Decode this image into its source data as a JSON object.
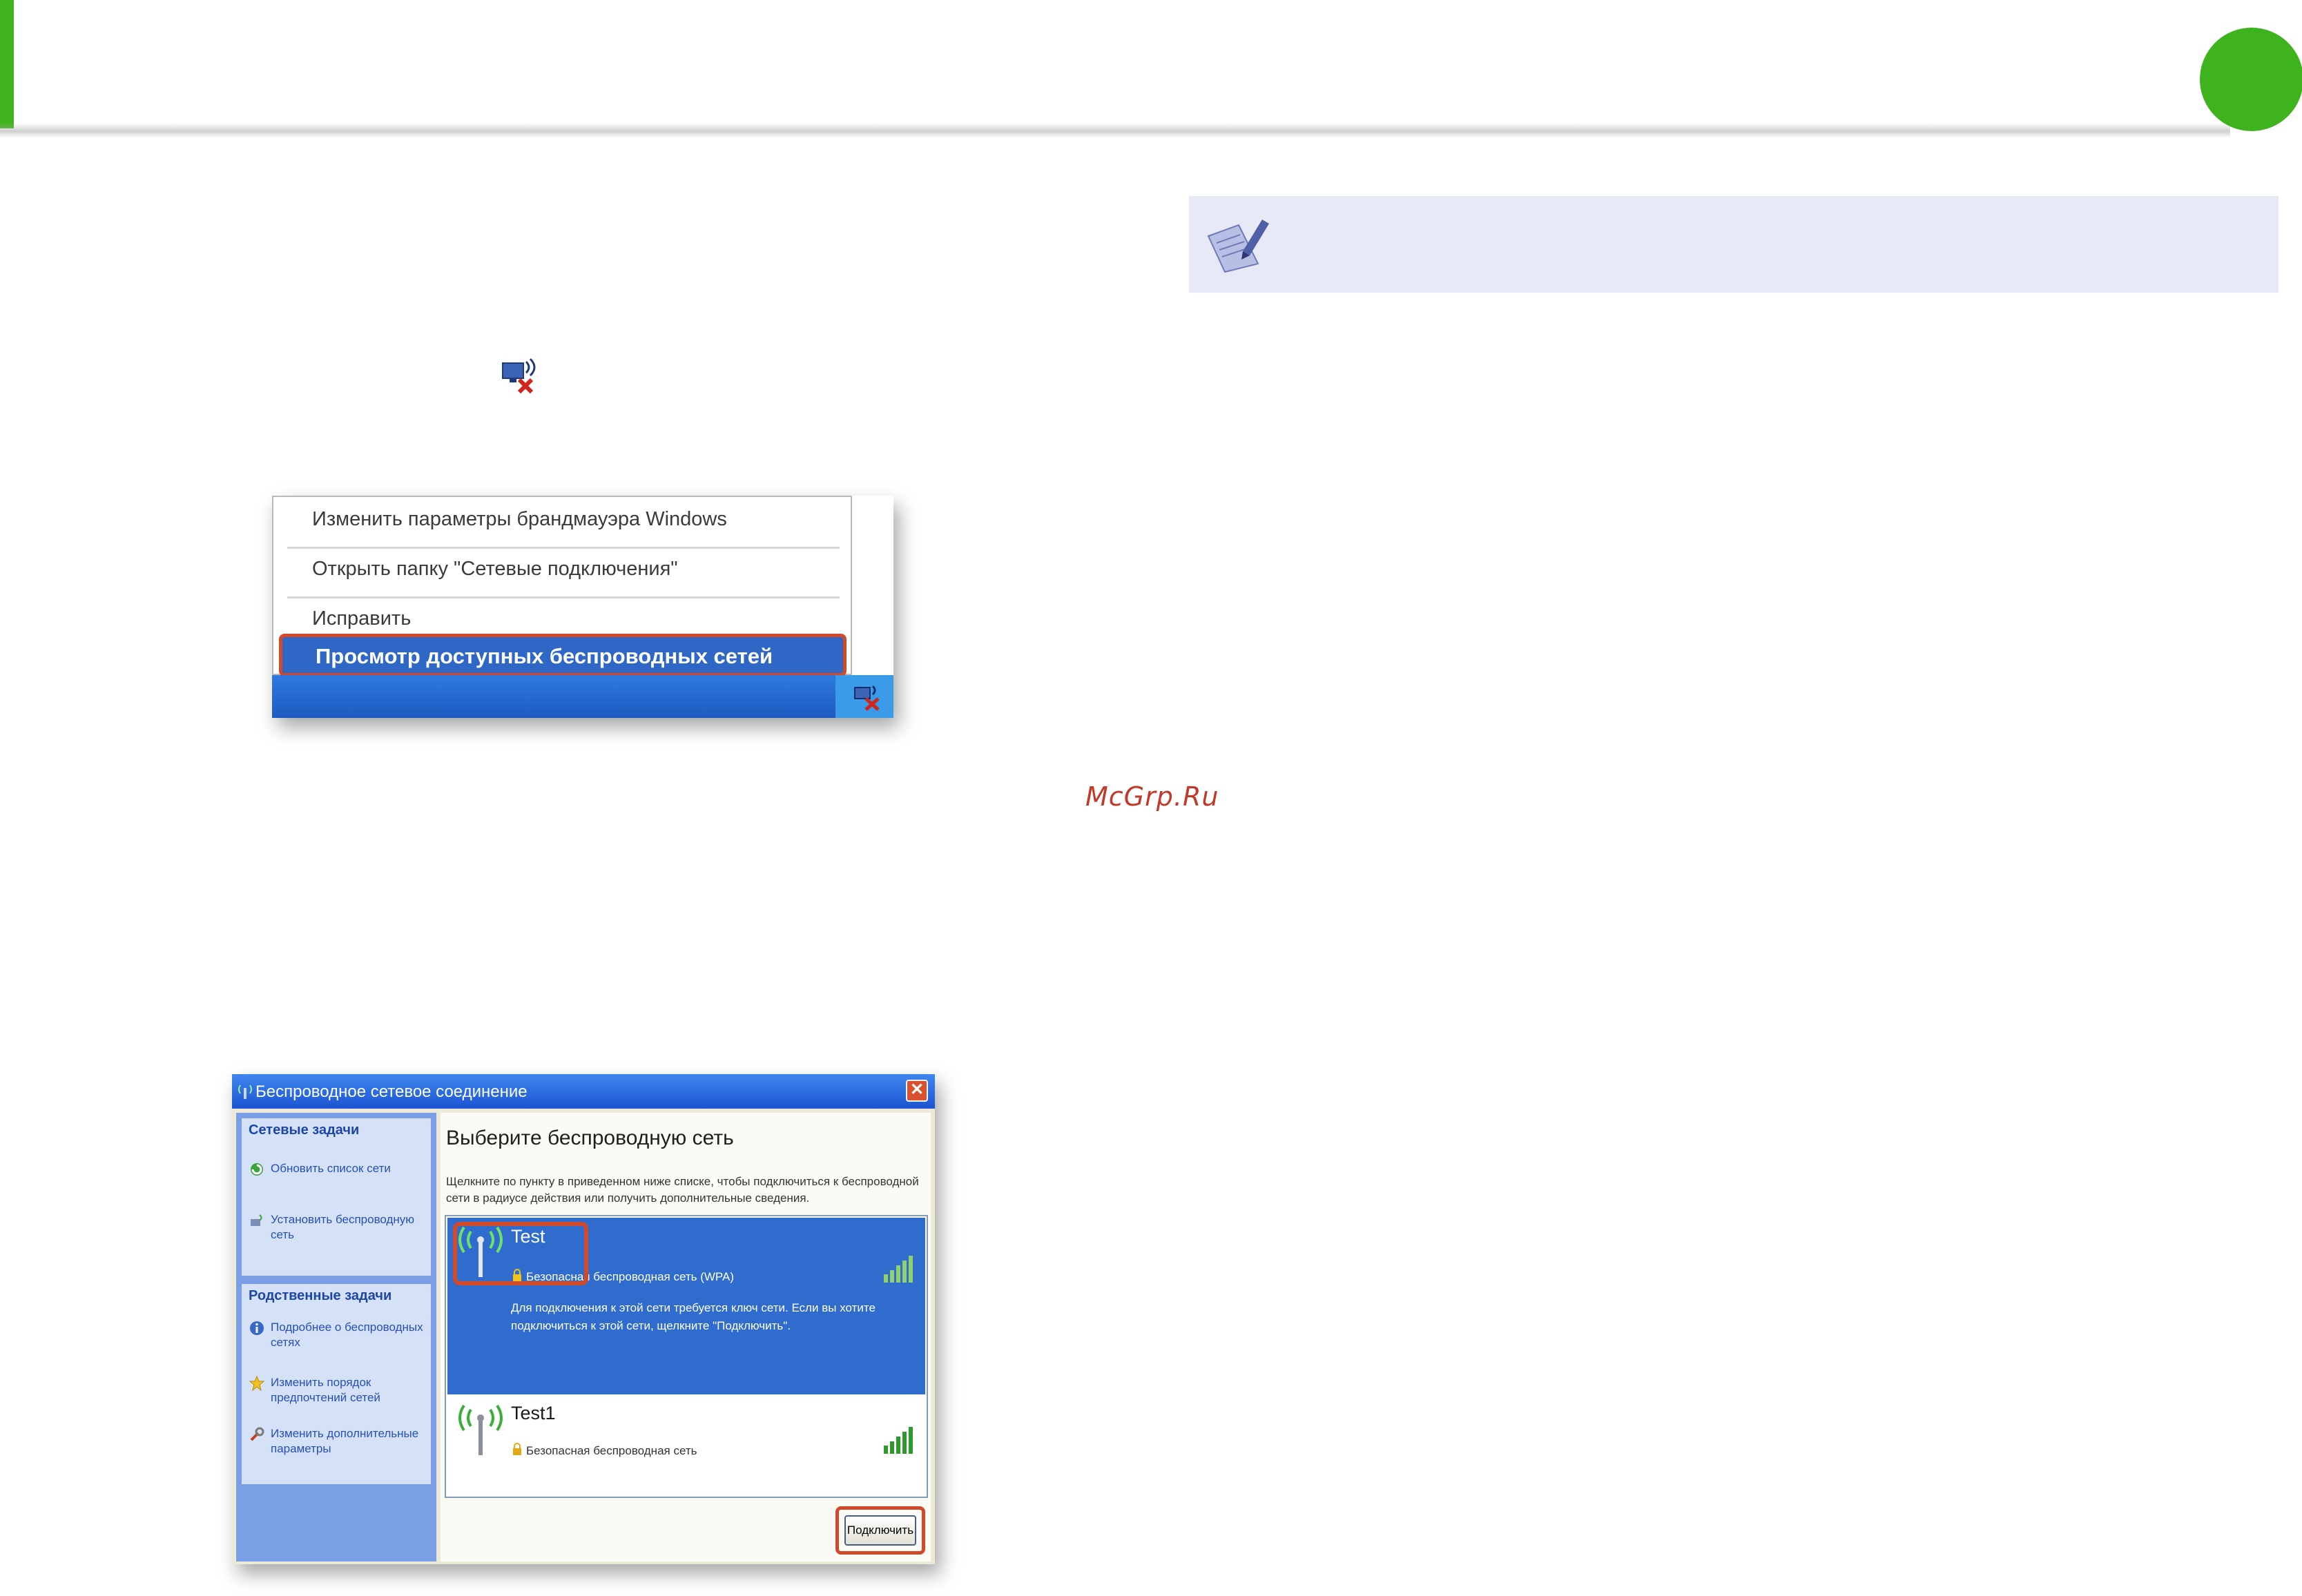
{
  "colors": {
    "brand_green": "#3fb31e",
    "note_bg": "#e8e9f6",
    "highlight_outline": "#d04a2a",
    "selection_blue": "#2f6ccd"
  },
  "note": {
    "icon": "note-pencil-icon"
  },
  "inline_icon": "wireless-disconnected-icon",
  "watermark": "McGrp.Ru",
  "context_menu": {
    "items": [
      "Изменить параметры брандмауэра Windows",
      "Открыть папку \"Сетевые подключения\"",
      "Исправить"
    ],
    "highlighted_item": "Просмотр доступных беспроводных сетей"
  },
  "dialog": {
    "title": "Беспроводное сетевое соединение",
    "sidebar": {
      "network_tasks_header": "Сетевые задачи",
      "network_tasks": [
        "Обновить список сети",
        "Установить беспроводную сеть"
      ],
      "related_tasks_header": "Родственные задачи",
      "related_tasks": [
        "Подробнее о беспроводных сетях",
        "Изменить порядок предпочтений сетей",
        "Изменить дополнительные параметры"
      ]
    },
    "main_title": "Выберите беспроводную сеть",
    "description": "Щелкните по пункту в приведенном ниже списке, чтобы подключиться к беспроводной сети в радиусе действия или получить дополнительные сведения.",
    "networks": [
      {
        "name": "Test",
        "security": "Безопасная беспроводная сеть (WPA)",
        "detail": "Для подключения к этой сети требуется ключ сети. Если вы хотите подключиться к этой сети, щелкните \"Подключить\".",
        "selected": true
      },
      {
        "name": "Test1",
        "security": "Безопасная беспроводная сеть",
        "selected": false
      }
    ],
    "connect_button": "Подключить"
  }
}
